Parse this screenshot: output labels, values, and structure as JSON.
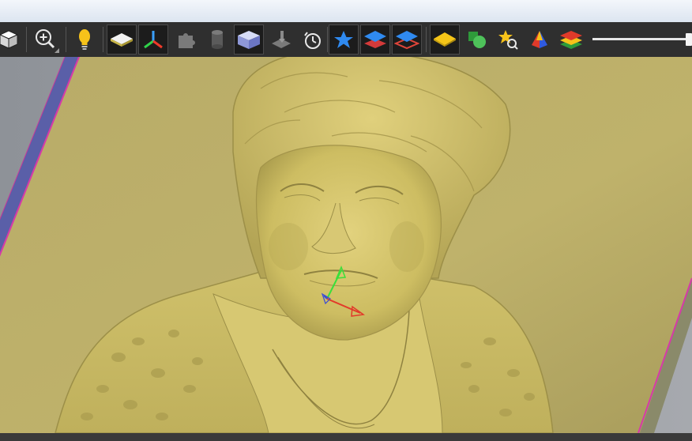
{
  "window": {
    "title": ""
  },
  "toolbar": {
    "buttons": [
      {
        "name": "view-cube-button",
        "icon": "cube-icon",
        "active": false
      },
      {
        "name": "zoom-button",
        "icon": "zoom-in-icon",
        "active": false
      },
      {
        "name": "lighting-button",
        "icon": "lightbulb-icon",
        "active": false
      },
      {
        "name": "material-plane-button",
        "icon": "plane-icon",
        "active": true
      },
      {
        "name": "axes-button",
        "icon": "axes-icon",
        "active": true
      },
      {
        "name": "component-button",
        "icon": "puzzle-icon",
        "active": false
      },
      {
        "name": "cylinder-button",
        "icon": "cylinder-icon",
        "active": false
      },
      {
        "name": "solid-block-button",
        "icon": "block-icon",
        "active": true
      },
      {
        "name": "tool-button",
        "icon": "tool-icon",
        "active": false
      },
      {
        "name": "clock-button",
        "icon": "clock-icon",
        "active": false
      },
      {
        "name": "star-button",
        "icon": "star-icon",
        "active": true
      },
      {
        "name": "layers-button",
        "icon": "layers-icon",
        "active": true
      },
      {
        "name": "layers-red-button",
        "icon": "layers-outline-icon",
        "active": true
      },
      {
        "name": "diamond-plane-button",
        "icon": "diamond-plane-icon",
        "active": true
      },
      {
        "name": "shapes-button",
        "icon": "shapes-icon",
        "active": false
      },
      {
        "name": "star-search-button",
        "icon": "star-search-icon",
        "active": false
      },
      {
        "name": "pyramid-button",
        "icon": "pyramid-icon",
        "active": false
      },
      {
        "name": "color-layers-button",
        "icon": "color-layers-icon",
        "active": false
      }
    ],
    "zoom_level": 1.0
  },
  "viewport": {
    "model": "relief-portrait",
    "colors": {
      "relief": "#c9bb63",
      "background": "#8a8f97",
      "plane_edge": "#d63aa8",
      "axis_x": "#e23a2a",
      "axis_y": "#3adf3a",
      "axis_z": "#3a4ad6"
    }
  }
}
